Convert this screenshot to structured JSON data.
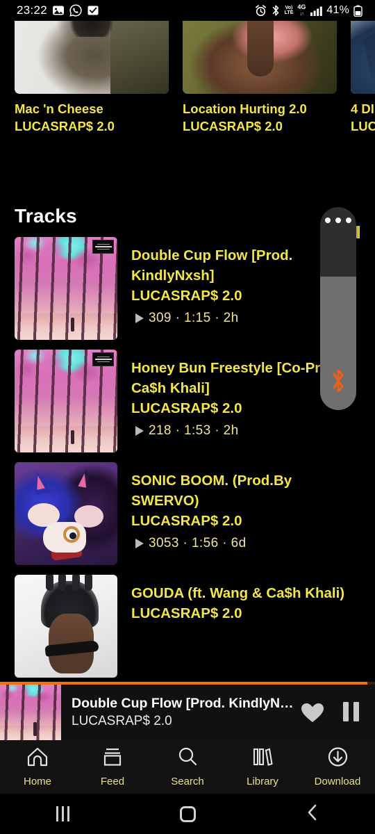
{
  "status_bar": {
    "time": "23:22",
    "left_icons": [
      "image-icon",
      "whatsapp-icon",
      "checkbox-icon"
    ],
    "right_icons": [
      "alarm-icon",
      "bluetooth-icon",
      "volte-icon",
      "network-4g-icon",
      "signal-bars-icon"
    ],
    "volte_top": "Vo)",
    "volte_bottom": "LTE",
    "network": "4G",
    "network_arrows": "↓↑",
    "battery_percent": "41%"
  },
  "carousel": {
    "items": [
      {
        "title": "Mac 'n Cheese",
        "artist": "LUCASRAP$ 2.0",
        "art": "photo-person-eating"
      },
      {
        "title": "Location Hurting 2.0",
        "artist": "LUCASRAP$ 2.0",
        "art": "photo-person-finger"
      },
      {
        "title": "4 DI",
        "artist": "LUC",
        "art": "photo-blue"
      }
    ]
  },
  "tracks_section": {
    "heading": "Tracks",
    "items": [
      {
        "title": "Double Cup Flow [Prod. KindlyNxsh]",
        "artist": "LUCASRAP$ 2.0",
        "plays": "309",
        "duration": "1:15",
        "age": "2h",
        "stats": "309 · 1:15 · 2h",
        "explicit": true,
        "art": "pink-forest-cover"
      },
      {
        "title": "Honey Bun Freestyle [Co-Prod. Ca$h Khali]",
        "artist": "LUCASRAP$ 2.0",
        "plays": "218",
        "duration": "1:53",
        "age": "2h",
        "stats": "218 · 1:53 · 2h",
        "explicit": true,
        "art": "pink-forest-cover"
      },
      {
        "title": "SONIC BOOM. (Prod.By SWERVO)",
        "artist": "LUCASRAP$ 2.0",
        "plays": "3053",
        "duration": "1:56",
        "age": "6d",
        "stats": "3053 · 1:56 · 6d",
        "explicit": false,
        "art": "sonic-shadow-cover"
      },
      {
        "title": "GOUDA (ft. Wang & Ca$h Khali)",
        "artist": "LUCASRAP$ 2.0",
        "plays": "",
        "duration": "",
        "age": "",
        "stats": "",
        "explicit": false,
        "art": "portrait-sunglasses-cover"
      }
    ]
  },
  "floating_overlay": {
    "menu_icon": "more-dots-icon",
    "status_icon": "bluetooth-icon",
    "accent_color": "#e8621a"
  },
  "now_playing": {
    "title": "Double Cup Flow [Prod. KindlyN…",
    "artist": "LUCASRAP$ 2.0",
    "like_icon": "heart-icon",
    "transport_icon": "pause-icon",
    "progress_color": "#f2710a",
    "progress_percent": 98
  },
  "tab_bar": {
    "items": [
      {
        "label": "Home",
        "icon": "home-icon"
      },
      {
        "label": "Feed",
        "icon": "feed-icon"
      },
      {
        "label": "Search",
        "icon": "search-icon"
      },
      {
        "label": "Library",
        "icon": "library-icon"
      },
      {
        "label": "Download",
        "icon": "download-icon"
      }
    ]
  },
  "android_nav": {
    "recents": "recents-icon",
    "home": "home-square-icon",
    "back": "back-chevron-icon"
  },
  "colors": {
    "background": "#000000",
    "accent_yellow": "#f2e54a",
    "stat_yellow": "#efe49a",
    "tab_label": "#e6e08a",
    "orange": "#f2710a"
  }
}
